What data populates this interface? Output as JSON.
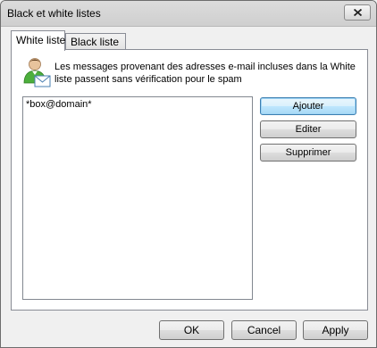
{
  "window": {
    "title": "Black et white listes"
  },
  "tabs": [
    {
      "label": "White liste",
      "active": true
    },
    {
      "label": "Black liste",
      "active": false
    }
  ],
  "panel": {
    "icon": "user-mail-icon",
    "description": "Les messages provenant des adresses e-mail incluses dans la White liste passent sans vérification pour le spam",
    "list_items": [
      "*box@domain*"
    ],
    "buttons": {
      "add": "Ajouter",
      "edit": "Editer",
      "delete": "Supprimer"
    }
  },
  "footer": {
    "ok": "OK",
    "cancel": "Cancel",
    "apply": "Apply"
  },
  "colors": {
    "accent": "#3c7fb1",
    "window_bg": "#f0f0f0"
  }
}
